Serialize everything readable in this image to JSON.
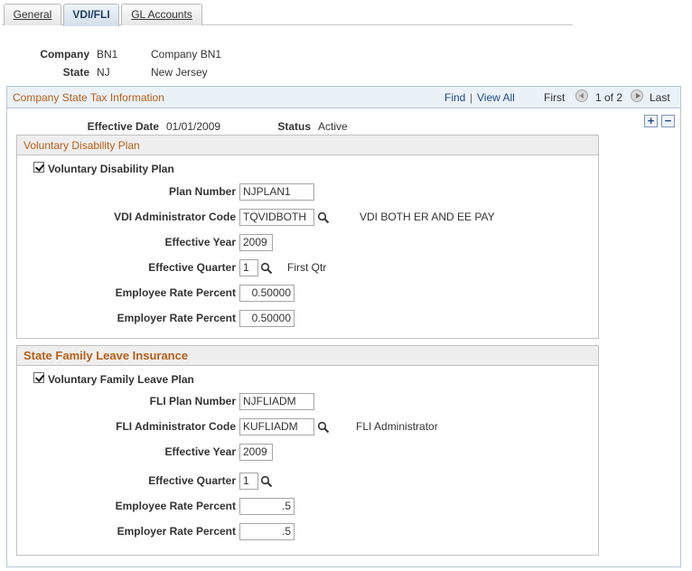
{
  "tabs": [
    {
      "label": "General",
      "active": false
    },
    {
      "label": "VDI/FLI",
      "active": true
    },
    {
      "label": "GL Accounts",
      "active": false
    }
  ],
  "header": {
    "company_label": "Company",
    "company_code": "BN1",
    "company_name": "Company BN1",
    "state_label": "State",
    "state_code": "NJ",
    "state_name": "New Jersey"
  },
  "grid": {
    "title": "Company State Tax Information",
    "find": "Find",
    "separator": "|",
    "view_all": "View All",
    "first": "First",
    "page": "1 of 2",
    "last": "Last",
    "add": "+",
    "remove": "−",
    "effective_date_label": "Effective Date",
    "effective_date": "01/01/2009",
    "status_label": "Status",
    "status": "Active"
  },
  "vdi": {
    "section_title": "Voluntary Disability Plan",
    "checkbox_label": "Voluntary Disability Plan",
    "checked": true,
    "plan_number_label": "Plan Number",
    "plan_number": "NJPLAN1",
    "admin_code_label": "VDI Administrator Code",
    "admin_code": "TQVIDBOTH",
    "admin_desc": "VDI BOTH ER AND EE PAY",
    "eff_year_label": "Effective Year",
    "eff_year": "2009",
    "eff_quarter_label": "Effective Quarter",
    "eff_quarter": "1",
    "eff_quarter_desc": "First Qtr",
    "emp_rate_label": "Employee Rate Percent",
    "emp_rate": "0.50000",
    "er_rate_label": "Employer Rate Percent",
    "er_rate": "0.50000"
  },
  "fli": {
    "section_title": "State Family Leave Insurance",
    "checkbox_label": "Voluntary Family Leave Plan",
    "checked": true,
    "plan_number_label": "FLI Plan Number",
    "plan_number": "NJFLIADM",
    "admin_code_label": "FLI Administrator Code",
    "admin_code": "KUFLIADM",
    "admin_desc": "FLI Administrator",
    "eff_year_label": "Effective Year",
    "eff_year": "2009",
    "eff_quarter_label": "Effective Quarter",
    "eff_quarter": "1",
    "emp_rate_label": "Employee Rate Percent",
    "emp_rate": ".5",
    "er_rate_label": "Employer Rate Percent",
    "er_rate": ".5"
  },
  "icons": {
    "lookup": "magnifier-icon",
    "prev": "arrow-left-circle-icon",
    "next": "arrow-right-circle-icon"
  },
  "colors": {
    "section_title": "#b85f18",
    "link": "#244b8a",
    "grid_border": "#b4c7d7"
  }
}
